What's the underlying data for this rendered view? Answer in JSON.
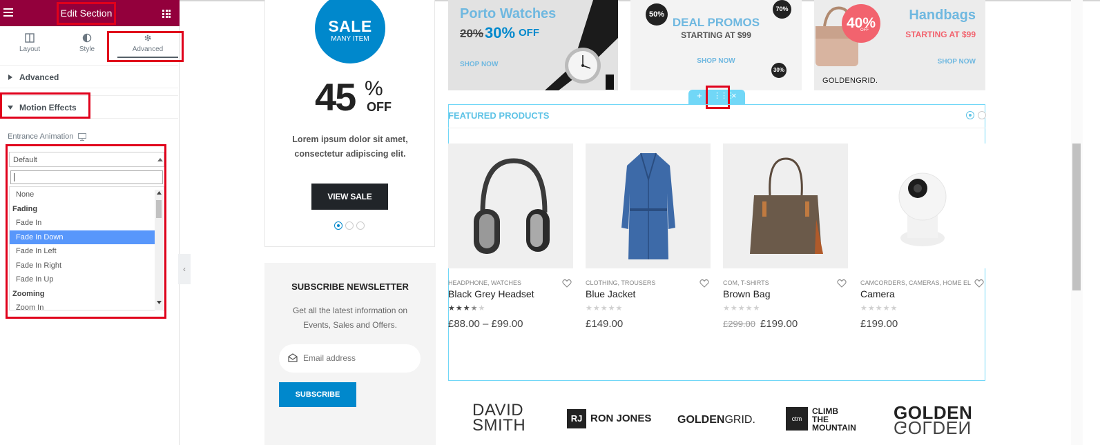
{
  "sidebar": {
    "title": "Edit Section",
    "tabs": [
      {
        "label": "Layout",
        "icon": "columns-icon"
      },
      {
        "label": "Style",
        "icon": "contrast-icon"
      },
      {
        "label": "Advanced",
        "icon": "gear-icon"
      }
    ],
    "sections": {
      "advanced": "Advanced",
      "motion": "Motion Effects"
    },
    "entrance_label": "Entrance Animation",
    "select_value": "Default",
    "options": [
      {
        "label": "None",
        "group": false
      },
      {
        "label": "Fading",
        "group": true
      },
      {
        "label": "Fade In",
        "group": false
      },
      {
        "label": "Fade In Down",
        "group": false,
        "selected": true
      },
      {
        "label": "Fade In Left",
        "group": false
      },
      {
        "label": "Fade In Right",
        "group": false
      },
      {
        "label": "Fade In Up",
        "group": false
      },
      {
        "label": "Zooming",
        "group": true
      },
      {
        "label": "Zoom In",
        "group": false
      }
    ]
  },
  "sale": {
    "badge_top": "SALE",
    "badge_bottom": "MANY ITEM",
    "percent": "45",
    "percent_sign": "%",
    "off": "OFF",
    "description": "Lorem ipsum dolor sit amet, consectetur adipiscing elit.",
    "button": "VIEW SALE"
  },
  "newsletter": {
    "title": "SUBSCRIBE NEWSLETTER",
    "description": "Get all the latest information on Events, Sales and Offers.",
    "placeholder": "Email address",
    "button": "SUBSCRIBE"
  },
  "banners": {
    "watches": {
      "title": "Porto Watches",
      "old": "20%",
      "new": "30%",
      "off": "OFF",
      "link": "SHOP NOW",
      "brand": "CLIMB THE MOUNTAIN"
    },
    "deals": {
      "title": "DEAL PROMOS",
      "sub": "STARTING AT $99",
      "link": "SHOP NOW",
      "badge1": "50%",
      "badge2": "70%",
      "badge3": "30%"
    },
    "handbags": {
      "title": "Handbags",
      "sub": "STARTING AT $99",
      "badge": "40%",
      "badge_off": "OFF",
      "link": "SHOP NOW",
      "brand": "GOLDENGRID."
    }
  },
  "featured": {
    "title": "FEATURED PRODUCTS",
    "products": [
      {
        "category": "HEADPHONE, WATCHES",
        "name": "Black Grey Headset",
        "rating": 3.5,
        "old_price": "",
        "price": "£88.00 – £99.00"
      },
      {
        "category": "CLOTHING, TROUSERS",
        "name": "Blue Jacket",
        "rating": 0,
        "old_price": "",
        "price": "£149.00"
      },
      {
        "category": "COM, T-SHIRTS",
        "name": "Brown Bag",
        "rating": 0,
        "old_price": "£299.00",
        "price": "£199.00"
      },
      {
        "category": "CAMCORDERS, CAMERAS, HOME EL...",
        "name": "Camera",
        "rating": 0,
        "old_price": "",
        "price": "£199.00"
      }
    ]
  },
  "brands": {
    "david_top": "DAVID",
    "david_bottom": "SMITH",
    "rj": "RJ",
    "ron_jones": "RON JONES",
    "goldengrid_bold": "GOLDEN",
    "goldengrid_light": "GRID.",
    "ctm": "ctm",
    "ctm_1": "CLIMB",
    "ctm_2": "THE",
    "ctm_3": "MOUNTAIN",
    "golden_top": "GOLDEN",
    "golden_bottom": "GOLDEN"
  },
  "colors": {
    "sidebar_header": "#93003c",
    "accent_blue": "#0088cc",
    "highlight": "#e0001b",
    "select_blue": "#5897fb",
    "section_cyan": "#71d7f7"
  }
}
